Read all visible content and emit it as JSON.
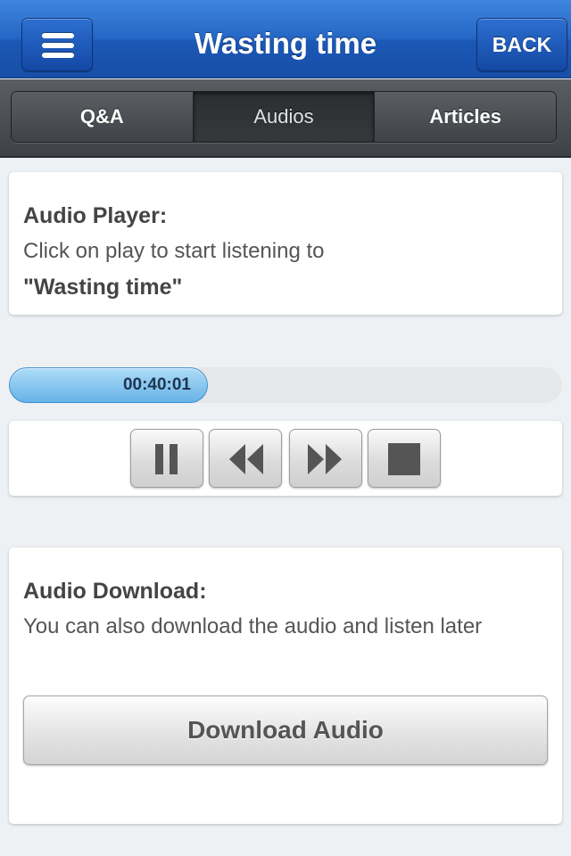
{
  "header": {
    "title": "Wasting time",
    "back_label": "BACK",
    "menu_icon": "hamburger-menu-icon"
  },
  "tabs": [
    {
      "label": "Q&A",
      "active": false
    },
    {
      "label": "Audios",
      "active": true
    },
    {
      "label": "Articles",
      "active": false
    }
  ],
  "player_info": {
    "heading": "Audio Player:",
    "text": "Click on play to start listening to",
    "audio_title": "\"Wasting time\""
  },
  "progress": {
    "time": "00:40:01",
    "fraction": 0.36
  },
  "controls": [
    {
      "name": "pause-button",
      "icon": "pause-icon"
    },
    {
      "name": "rewind-button",
      "icon": "rewind-icon"
    },
    {
      "name": "fast-forward-button",
      "icon": "fast-forward-icon"
    },
    {
      "name": "stop-button",
      "icon": "stop-icon"
    }
  ],
  "download": {
    "heading": "Audio Download:",
    "text": "You can also download the audio and listen later",
    "button_label": "Download Audio"
  },
  "colors": {
    "header_blue": "#2566c4",
    "progress_blue": "#66b3e8",
    "background": "#eef1f4"
  }
}
